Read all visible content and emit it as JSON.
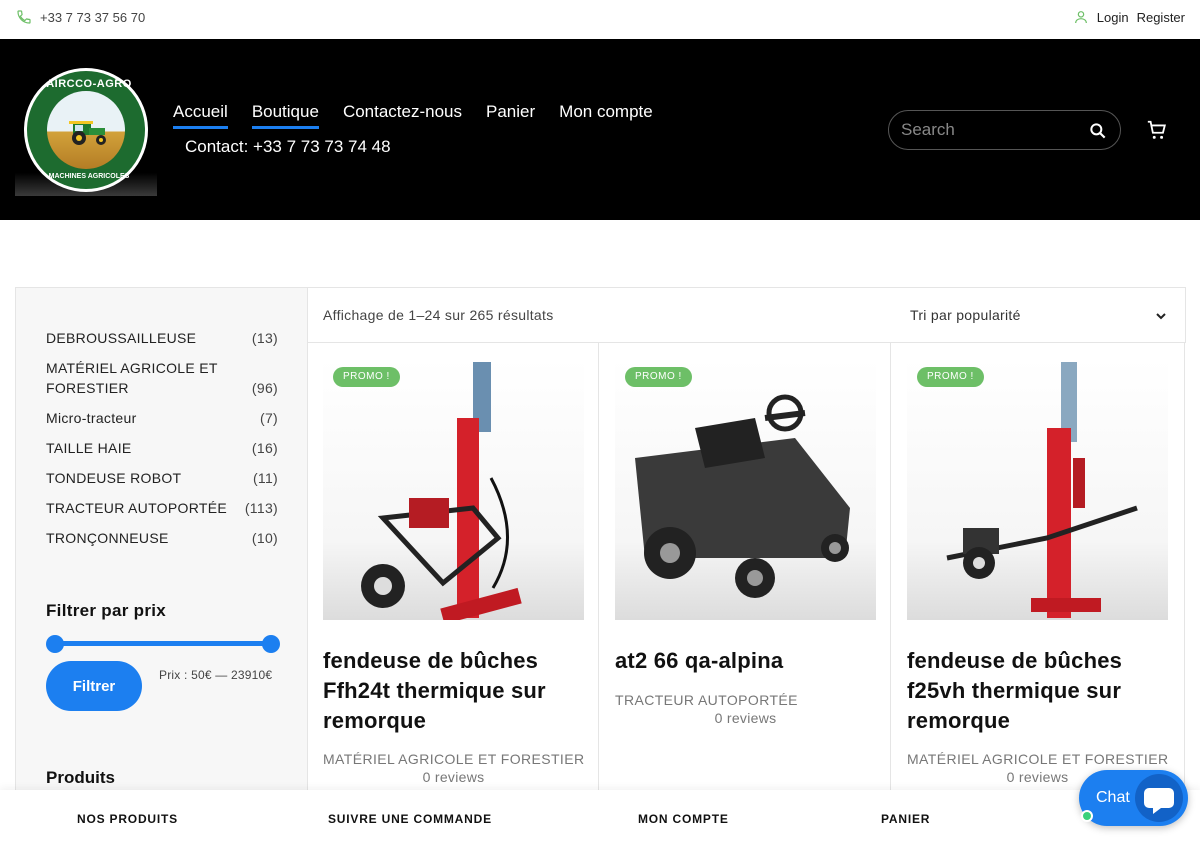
{
  "topbar": {
    "phone": "+33 7 73 37 56 70",
    "login": "Login",
    "register": "Register"
  },
  "header": {
    "logo_top": "AIRCCO-AGRO",
    "logo_bottom": "MACHINES AGRICOLES",
    "nav": [
      "Accueil",
      "Boutique",
      "Contactez-nous",
      "Panier",
      "Mon compte"
    ],
    "contact": "Contact: +33 7 73 73 74 48",
    "search_placeholder": "Search"
  },
  "sidebar": {
    "categories": [
      {
        "name": "DEBROUSSAILLEUSE",
        "count": "(13)"
      },
      {
        "name": "MATÉRIEL AGRICOLE ET FORESTIER",
        "count": "(96)"
      },
      {
        "name": "Micro-tracteur",
        "count": "(7)"
      },
      {
        "name": "TAILLE HAIE",
        "count": "(16)"
      },
      {
        "name": "TONDEUSE ROBOT",
        "count": "(11)"
      },
      {
        "name": "TRACTEUR AUTOPORTÉE",
        "count": "(113)"
      },
      {
        "name": "TRONÇONNEUSE",
        "count": "(10)"
      }
    ],
    "filter_title": "Filtrer par prix",
    "filter_button": "Filtrer",
    "price_label": "Prix : 50€ — 23910€",
    "products_title": "Produits"
  },
  "results": {
    "count_text": "Affichage de 1–24 sur 265 résultats",
    "sort_selected": "Tri par popularité"
  },
  "products": [
    {
      "badge": "PROMO !",
      "title": "fendeuse de bûches Ffh24t thermique sur remorque",
      "category": "MATÉRIEL AGRICOLE ET FORESTIER",
      "reviews": "0 reviews"
    },
    {
      "badge": "PROMO !",
      "title": "at2 66 qa-alpina",
      "category": "TRACTEUR AUTOPORTÉE",
      "reviews": "0 reviews"
    },
    {
      "badge": "PROMO !",
      "title": "fendeuse de bûches f25vh thermique sur remorque",
      "category": "MATÉRIEL AGRICOLE ET FORESTIER",
      "reviews": "0 reviews"
    }
  ],
  "bottombar": {
    "items": [
      "NOS PRODUITS",
      "SUIVRE UNE COMMANDE",
      "MON COMPTE",
      "PANIER"
    ]
  },
  "chat": {
    "label": "Chat"
  },
  "colors": {
    "accent": "#1c7ff0",
    "promo": "#6dbf67",
    "header_bg": "#000000"
  }
}
